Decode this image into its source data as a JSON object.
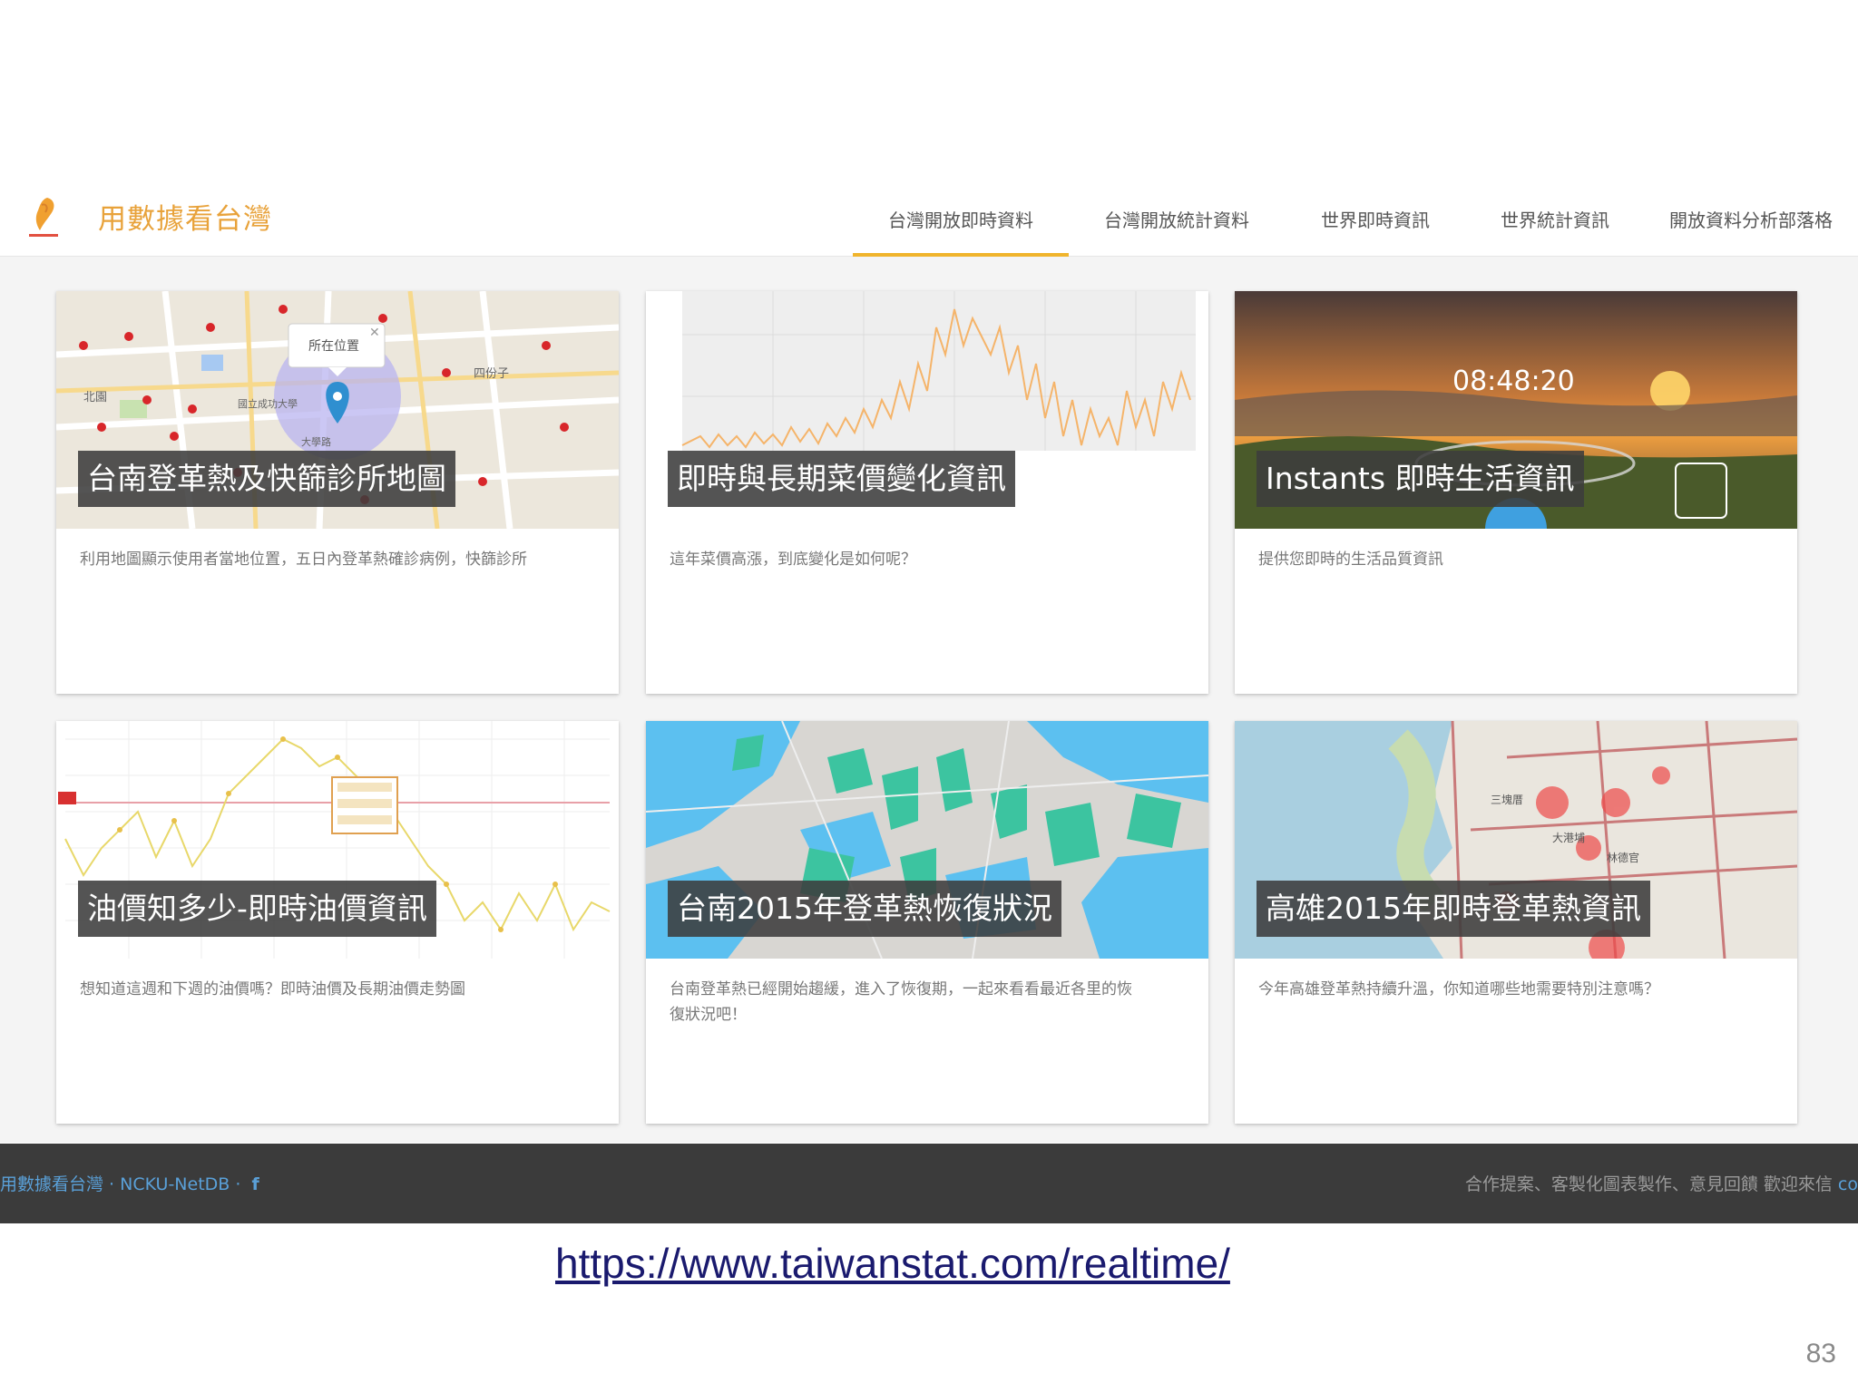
{
  "header": {
    "title": "用數據看台灣",
    "nav": [
      {
        "label": "台灣開放即時資料",
        "active": true
      },
      {
        "label": "台灣開放統計資料",
        "active": false
      },
      {
        "label": "世界即時資訊",
        "active": false
      },
      {
        "label": "世界統計資訊",
        "active": false
      },
      {
        "label": "開放資料分析部落格",
        "active": false
      }
    ]
  },
  "cards": [
    {
      "title": "台南登革熱及快篩診所地圖",
      "desc": "利用地圖顯示使用者當地位置，五日內登革熱確診病例，快篩診所",
      "popup": "所在位置",
      "map_labels": [
        "北園",
        "四份子",
        "國立成功大學",
        "大學路"
      ]
    },
    {
      "title": "即時與長期菜價變化資訊",
      "desc": "這年菜價高漲，到底變化是如何呢？"
    },
    {
      "title": "Instants 即時生活資訊",
      "desc": "提供您即時的生活品質資訊",
      "time": "08:48:20"
    },
    {
      "title": "油價知多少-即時油價資訊",
      "desc": "想知道這週和下週的油價嗎？即時油價及長期油價走勢圖"
    },
    {
      "title": "台南2015年登革熱恢復狀況",
      "desc": "台南登革熱已經開始趨緩，進入了恢復期，一起來看看最近各里的恢復狀況吧！"
    },
    {
      "title": "高雄2015年即時登革熱資訊",
      "desc": "今年高雄登革熱持續升溫，你知道哪些地需要特別注意嗎？",
      "map_labels": [
        "三塊厝",
        "大港埔",
        "林德官"
      ]
    }
  ],
  "footer": {
    "left": "用數據看台灣 · NCKU-NetDB ·",
    "fb_icon": "f",
    "right": "合作提案、客製化圖表製作、意見回饋 歡迎來信",
    "right_tail": "co"
  },
  "slide": {
    "url": "https://www.taiwanstat.com/realtime/",
    "page_number": "83"
  },
  "colors": {
    "accent": "#f0b42c",
    "title_orange": "#e8a23a",
    "footer_bg": "#3b3b3b"
  }
}
